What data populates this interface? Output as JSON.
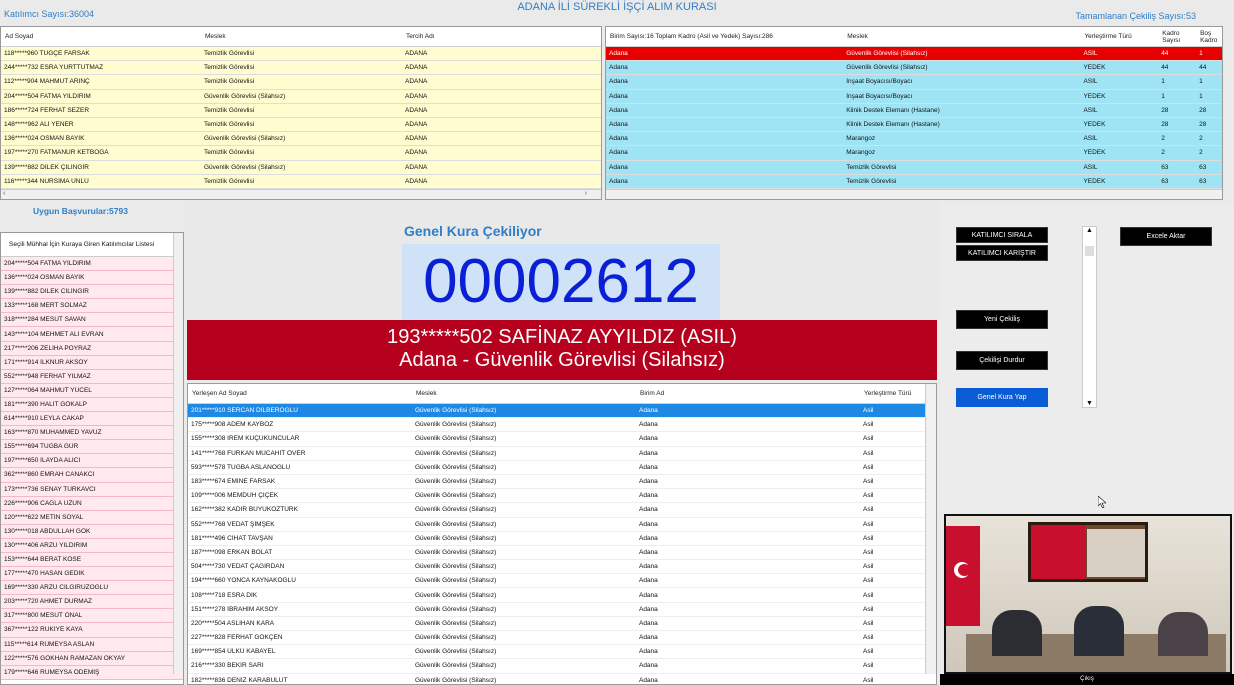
{
  "header": {
    "title": "ADANA İLİ SÜREKLİ İŞÇİ ALIM KURASI",
    "participants": "Katılımcı Sayısı:36004",
    "completed": "Tamamlanan Çekiliş Sayısı:53"
  },
  "participants_table": {
    "columns": [
      "Ad Soyad",
      "Meslek",
      "Tercih Adı"
    ],
    "rows": [
      [
        "118*****960 TUĞÇE FARSAK",
        "Temizlik Görevlisi",
        "ADANA"
      ],
      [
        "244*****732 ESRA YURTTUTMAZ",
        "Temizlik Görevlisi",
        "ADANA"
      ],
      [
        "112*****904 MAHMUT ARINÇ",
        "Temizlik Görevlisi",
        "ADANA"
      ],
      [
        "204*****504 FATMA YILDIRIM",
        "Güvenlik Görevlisi (Silahsız)",
        "ADANA"
      ],
      [
        "186*****724 FERHAT SEZER",
        "Temizlik Görevlisi",
        "ADANA"
      ],
      [
        "148*****962 ALİ YENER",
        "Temizlik Görevlisi",
        "ADANA"
      ],
      [
        "136*****024 OSMAN BAYIK",
        "Güvenlik Görevlisi (Silahsız)",
        "ADANA"
      ],
      [
        "197*****270 FATMANUR KETBOĞA",
        "Temizlik Görevlisi",
        "ADANA"
      ],
      [
        "139*****882 DİLEK ÇİLİNGİR",
        "Güvenlik Görevlisi (Silahsız)",
        "ADANA"
      ],
      [
        "116*****344 NURSİMA ÜNLÜ",
        "Temizlik Görevlisi",
        "ADANA"
      ]
    ]
  },
  "positions_table": {
    "columns": [
      "Birim Sayısı:16 Toplam Kadro (Asil ve Yedek) Sayısı:286",
      "Meslek",
      "Yerleştirme Türü",
      "Kadro Sayısı",
      "Boş Kadro"
    ],
    "rows": [
      [
        "Adana",
        "Güvenlik Görevlisi (Silahsız)",
        "ASİL",
        "44",
        "1"
      ],
      [
        "Adana",
        "Güvenlik Görevlisi (Silahsız)",
        "YEDEK",
        "44",
        "44"
      ],
      [
        "Adana",
        "İnşaat Boyacısı/Boyacı",
        "ASİL",
        "1",
        "1"
      ],
      [
        "Adana",
        "İnşaat Boyacısı/Boyacı",
        "YEDEK",
        "1",
        "1"
      ],
      [
        "Adana",
        "Klinik Destek Elemanı (Hastane)",
        "ASİL",
        "28",
        "28"
      ],
      [
        "Adana",
        "Klinik Destek Elemanı (Hastane)",
        "YEDEK",
        "28",
        "28"
      ],
      [
        "Adana",
        "Marangoz",
        "ASİL",
        "2",
        "2"
      ],
      [
        "Adana",
        "Marangoz",
        "YEDEK",
        "2",
        "2"
      ],
      [
        "Adana",
        "Temizlik Görevlisi",
        "ASİL",
        "63",
        "63"
      ],
      [
        "Adana",
        "Temizlik Görevlisi",
        "YEDEK",
        "63",
        "63"
      ]
    ]
  },
  "eligible": {
    "count_label": "Uygun Başvurular:5793",
    "list_title": "Seçili Mühhal İçin Kuraya Giren Katılımcılar Listesi",
    "items": [
      "204*****504 FATMA YILDIRIM",
      "136*****024 OSMAN BAYIK",
      "139*****882 DİLEK CİLİNGİR",
      "133*****168 MERT SOLMAZ",
      "318*****284 MESUT SAVAN",
      "143*****104 MEHMET ALİ EVRAN",
      "217*****206 ZELİHA POYRAZ",
      "171*****914 İLKNUR AKSOY",
      "552*****948 FERHAT YILMAZ",
      "127*****064 MAHMUT YÜCEL",
      "181*****390 HALİT GÖKALP",
      "614*****910 LEYLA CAKAP",
      "163*****870 MUHAMMED YAVUZ",
      "155*****694 TUĞBA GÜR",
      "197*****650 İLAYDA ALICI",
      "362*****860 EMRAH CANAKCI",
      "173*****736 SENAY TÜRKAVCI",
      "226*****906 CAĞLA UZUN",
      "120*****622 METİN SOYAL",
      "130*****018 ABDULLAH GÖK",
      "130*****406 ARZU YILDIRIM",
      "153*****644 BERAT KÖSE",
      "177*****470 HASAN GEDİK",
      "169*****330 ARZU CİLGİRÜZOĞLU",
      "203*****720 AHMET DURMAZ",
      "317*****800 MESUT ÖNAL",
      "367*****122 RUKİYE KAYA",
      "115*****614 RÜMEYSA ASLAN",
      "122*****576 GÖKHAN RAMAZAN OKYAY",
      "179*****646 RUMEYSA ÖDEMİŞ"
    ]
  },
  "draw": {
    "status": "Genel Kura Çekiliyor",
    "number": "00002612",
    "winner_line1": "193*****502 SAFİNAZ AYYILDIZ (ASIL)",
    "winner_line2": "Adana - Güvenlik Görevlisi (Silahsız)"
  },
  "results_table": {
    "columns": [
      "Yerleşen Ad Soyad",
      "Meslek",
      "Birim Ad",
      "Yerleştirme Türü"
    ],
    "rows": [
      [
        "201*****910 SERCAN DİLBEROĞLU",
        "Güvenlik Görevlisi (Silahsız)",
        "Adana",
        "Asil"
      ],
      [
        "175*****908 ADEM KAYBOZ",
        "Güvenlik Görevlisi (Silahsız)",
        "Adana",
        "Asil"
      ],
      [
        "155*****308 İREM KÜÇÜKUNCULAR",
        "Güvenlik Görevlisi (Silahsız)",
        "Adana",
        "Asil"
      ],
      [
        "141*****768 FURKAN MÜCAHİT ÖVER",
        "Güvenlik Görevlisi (Silahsız)",
        "Adana",
        "Asil"
      ],
      [
        "593*****578 TUĞBA ASLANOĞLU",
        "Güvenlik Görevlisi (Silahsız)",
        "Adana",
        "Asil"
      ],
      [
        "183*****674 EMİNE FARSAK",
        "Güvenlik Görevlisi (Silahsız)",
        "Adana",
        "Asil"
      ],
      [
        "109*****006 MEMDUH ÇİÇEK",
        "Güvenlik Görevlisi (Silahsız)",
        "Adana",
        "Asil"
      ],
      [
        "162*****382 KADİR BÜYÜKÖZTÜRK",
        "Güvenlik Görevlisi (Silahsız)",
        "Adana",
        "Asil"
      ],
      [
        "552*****768 VEDAT ŞİMŞEK",
        "Güvenlik Görevlisi (Silahsız)",
        "Adana",
        "Asil"
      ],
      [
        "181*****496 CİHAT TAVŞAN",
        "Güvenlik Görevlisi (Silahsız)",
        "Adana",
        "Asil"
      ],
      [
        "187*****098 ERKAN BOLAT",
        "Güvenlik Görevlisi (Silahsız)",
        "Adana",
        "Asil"
      ],
      [
        "504*****730 VEDAT ÇAĞIRDAN",
        "Güvenlik Görevlisi (Silahsız)",
        "Adana",
        "Asil"
      ],
      [
        "194*****660 YONCA KAYNAKOĞLU",
        "Güvenlik Görevlisi (Silahsız)",
        "Adana",
        "Asil"
      ],
      [
        "108*****718 ESRA DİK",
        "Güvenlik Görevlisi (Silahsız)",
        "Adana",
        "Asil"
      ],
      [
        "151*****278 İBRAHİM AKSOY",
        "Güvenlik Görevlisi (Silahsız)",
        "Adana",
        "Asil"
      ],
      [
        "220*****504 ASLIHAN KARA",
        "Güvenlik Görevlisi (Silahsız)",
        "Adana",
        "Asil"
      ],
      [
        "227*****828 FERHAT GÖKÇEN",
        "Güvenlik Görevlisi (Silahsız)",
        "Adana",
        "Asil"
      ],
      [
        "169*****854 ÜLKÜ KABAYEL",
        "Güvenlik Görevlisi (Silahsız)",
        "Adana",
        "Asil"
      ],
      [
        "216*****330 BEKİR SARI",
        "Güvenlik Görevlisi (Silahsız)",
        "Adana",
        "Asil"
      ],
      [
        "182*****836 DENİZ KARABULUT",
        "Güvenlik Görevlisi (Silahsız)",
        "Adana",
        "Asil"
      ]
    ]
  },
  "buttons": {
    "sort": "KATILIMCI SIRALA",
    "shuffle": "KATILIMCI KARIŞTIR",
    "excel": "Excele Aktar",
    "new_draw": "Yeni Çekiliş",
    "stop": "Çekilişi Durdur",
    "general": "Genel Kura Yap",
    "exit": "Çıkış"
  },
  "colors": {
    "accent": "#2f7fc8",
    "winner_bg": "#b5001e",
    "selected_red": "#e60000",
    "selected_blue": "#1e88e5"
  },
  "icons": [
    "flag-icon",
    "portrait-icon",
    "mouse-cursor-icon"
  ]
}
